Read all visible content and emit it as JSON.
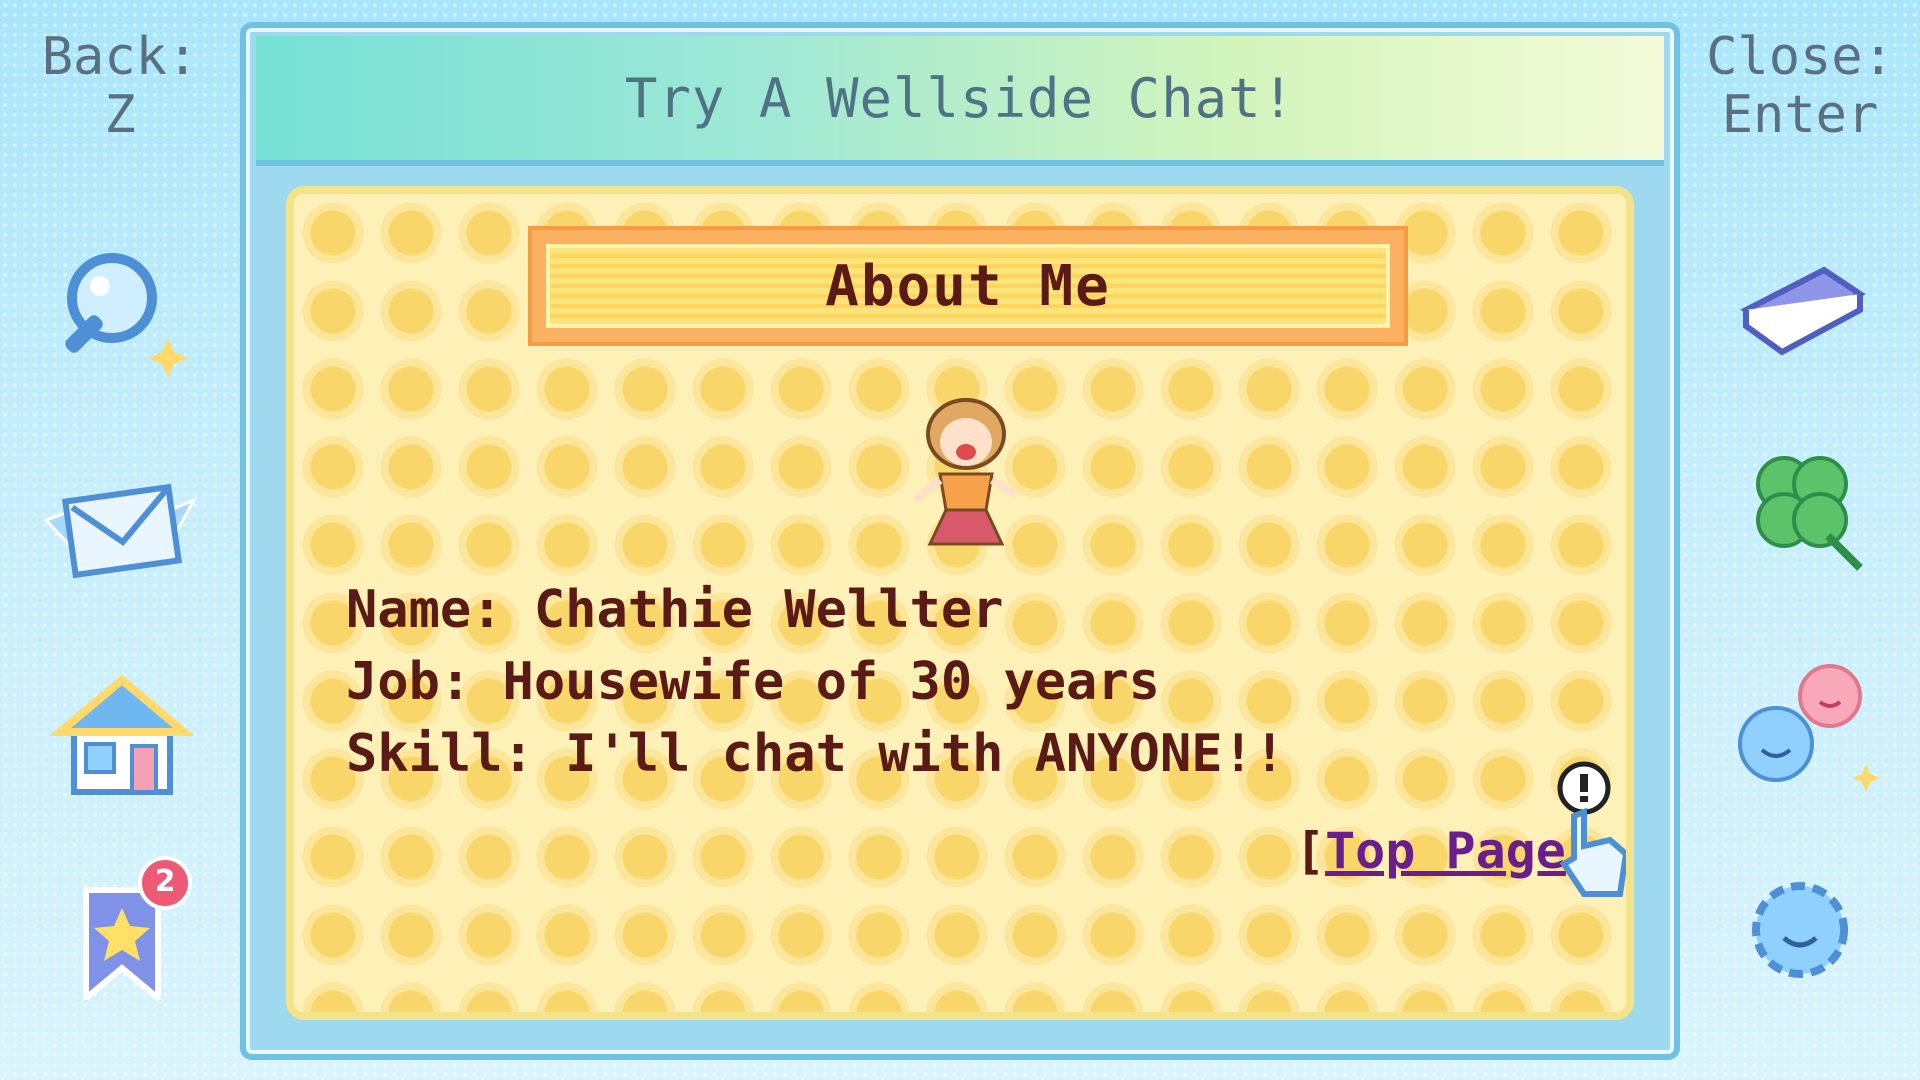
{
  "left_panel": {
    "back_hint": {
      "line1": "Back:",
      "line2": "Z"
    },
    "icons": [
      "magnifier-icon",
      "envelope-icon",
      "house-icon",
      "bookmark-icon"
    ],
    "bookmark_badge": "2"
  },
  "right_panel": {
    "close_hint": {
      "line1": "Close:",
      "line2": "Enter"
    },
    "icons": [
      "book-icon",
      "clover-icon",
      "smiley-friends-icon",
      "settings-gear-icon"
    ]
  },
  "window": {
    "title": "Try A Wellside Chat!",
    "header": "About Me",
    "profile": {
      "name": "Name: Chathie Wellter",
      "job": "Job: Housewife of 30 years",
      "skill": "Skill: I'll chat with ANYONE!!"
    },
    "link": {
      "open_bracket": "[",
      "label": "Top Page",
      "close_bracket": "]"
    }
  },
  "colors": {
    "background": "#c6eefc",
    "window_border": "#70c2e2",
    "title_text": "#4f7385",
    "content_bg": "#fdf1b8",
    "body_text": "#5a1a16",
    "link": "#6a1e8c",
    "badge": "#ee5a76"
  }
}
